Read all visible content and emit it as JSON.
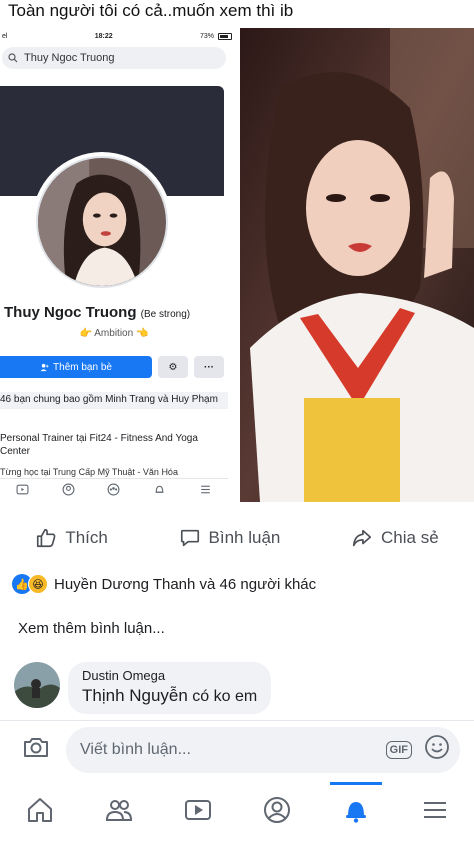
{
  "caption": "Toàn người tôi có cả..muốn xem thì ib",
  "phone": {
    "status": {
      "carrier": "el",
      "time": "18:22",
      "battery": "73%"
    },
    "search_value": "Thuy Ngoc Truong",
    "profile": {
      "name": "Thuy Ngoc Truong",
      "nickname": "(Be strong)",
      "bio": "👉 Ambition 👈",
      "add_friend_label": "Thêm bạn bè",
      "more_label": "···"
    },
    "info": {
      "mutual": "46 bạn chung bao gồm Minh Trang và Huy Phạm",
      "work": "Personal Trainer tại Fit24 - Fitness And Yoga Center",
      "study": "Từng học tại Trung Cấp Mỹ Thuật - Văn Hóa"
    }
  },
  "post_actions": {
    "like": "Thích",
    "comment": "Bình luận",
    "share": "Chia sẻ"
  },
  "reactions_text": "Huyền Dương Thanh và 46 người khác",
  "view_more": "Xem thêm bình luận...",
  "comment": {
    "author": "Dustin Omega",
    "mention": "Thịnh Nguyễn",
    "text": " có ko em"
  },
  "composer": {
    "placeholder": "Viết bình luận...",
    "gif_label": "GIF"
  },
  "bottom_nav": [
    "home-icon",
    "friends-icon",
    "watch-icon",
    "profile-icon",
    "notifications-icon",
    "menu-icon"
  ],
  "colors": {
    "accent": "#1877f2",
    "haha": "#f7b928"
  }
}
